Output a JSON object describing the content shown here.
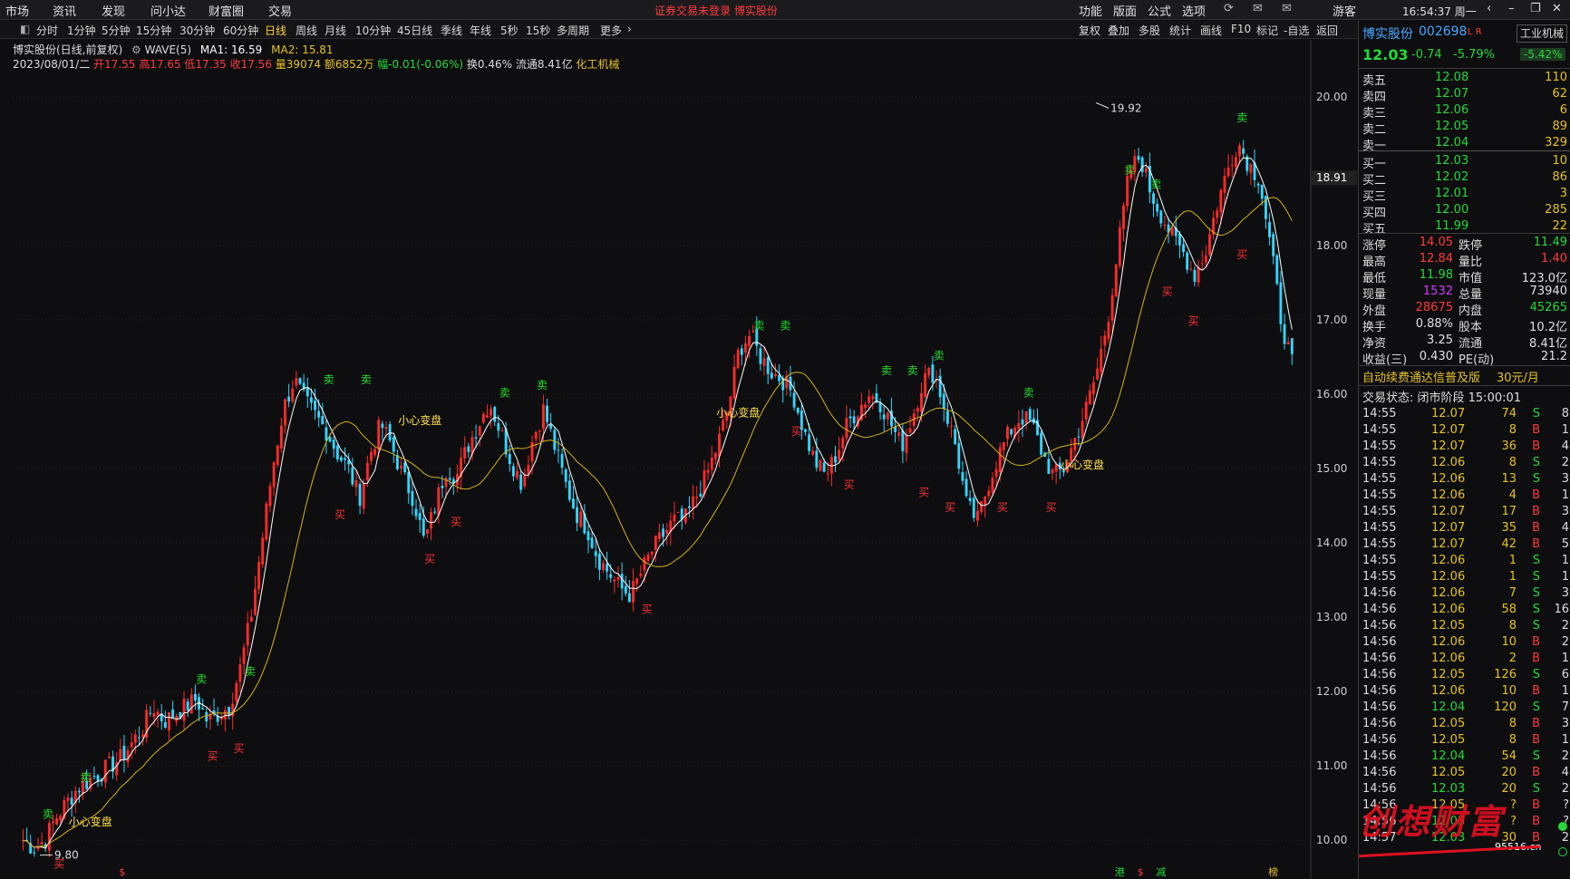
{
  "menu": [
    "市场",
    "资讯",
    "发现",
    "问小达",
    "财富圈",
    "交易"
  ],
  "alert": "证券交易未登录  博实股份",
  "right_menu": [
    "功能",
    "版面",
    "公式",
    "选项"
  ],
  "user": "游客",
  "clock": "16:54:37 周一",
  "periods": [
    "分时",
    "1分钟",
    "5分钟",
    "15分钟",
    "30分钟",
    "60分钟",
    "日线",
    "周线",
    "月线",
    "10分钟",
    "45日线",
    "季线",
    "年线",
    "5秒",
    "15秒",
    "多周期",
    "更多"
  ],
  "active_period": "日线",
  "tools": [
    "复权",
    "叠加",
    "多股",
    "统计",
    "画线",
    "F10",
    "标记",
    "-自选",
    "返回"
  ],
  "chart_title": "博实股份(日线,前复权)",
  "indicators": {
    "wave": "WAVE(5)",
    "ma1": "MA1: 16.59",
    "ma2": "MA2: 15.81"
  },
  "day_info": {
    "date": "2023/08/01/二",
    "open": "开17.55",
    "high": "高17.65",
    "low": "低17.35",
    "close": "收17.56",
    "volume": "量39074",
    "amount": "额6852万",
    "change": "幅-0.01(-0.06%)",
    "turnover": "换0.46%",
    "float": "流通8.41亿",
    "industry": "化工机械"
  },
  "price_axis": [
    "20.00",
    "18.00",
    "17.00",
    "16.00",
    "15.00",
    "14.00",
    "13.00",
    "12.00",
    "11.00",
    "10.00"
  ],
  "price_marker": "18.91",
  "max_label": "19.92",
  "min_label": "9.80",
  "signals": {
    "buy": "买",
    "sell": "卖",
    "caution": "小心变盘"
  },
  "bottom_marks": [
    "港",
    "$",
    "减",
    "榜"
  ],
  "colors": {
    "up": "#ff2a2a",
    "down": "#33d6ff",
    "ma1": "#ffffff",
    "ma2": "#d4b21e",
    "sell": "#26e02b",
    "buy": "#ff3030"
  },
  "quote": {
    "name": "博实股份",
    "code": "002698",
    "tag": "L R",
    "sector_button": "工业机械",
    "price": "12.03",
    "change": "-0.74",
    "pct": "-5.79%",
    "sector_pct": "-5.42%"
  },
  "asks": [
    {
      "label": "卖五",
      "price": "12.08",
      "vol": "110"
    },
    {
      "label": "卖四",
      "price": "12.07",
      "vol": "62"
    },
    {
      "label": "卖三",
      "price": "12.06",
      "vol": "6"
    },
    {
      "label": "卖二",
      "price": "12.05",
      "vol": "89"
    },
    {
      "label": "卖一",
      "price": "12.04",
      "vol": "329"
    }
  ],
  "bids": [
    {
      "label": "买一",
      "price": "12.03",
      "vol": "10"
    },
    {
      "label": "买二",
      "price": "12.02",
      "vol": "86"
    },
    {
      "label": "买三",
      "price": "12.01",
      "vol": "3"
    },
    {
      "label": "买四",
      "price": "12.00",
      "vol": "285"
    },
    {
      "label": "买五",
      "price": "11.99",
      "vol": "22"
    }
  ],
  "stats": [
    {
      "l1": "涨停",
      "v1": "14.05",
      "c1": "#ff3b3b",
      "l2": "跌停",
      "v2": "11.49",
      "c2": "#26d83a"
    },
    {
      "l1": "最高",
      "v1": "12.84",
      "c1": "#ff3b3b",
      "l2": "量比",
      "v2": "1.40",
      "c2": "#ff3b3b"
    },
    {
      "l1": "最低",
      "v1": "11.98",
      "c1": "#26d83a",
      "l2": "市值",
      "v2": "123.0亿",
      "c2": "#e0e0e0"
    },
    {
      "l1": "现量",
      "v1": "1532",
      "c1": "#d23cff",
      "l2": "总量",
      "v2": "73940",
      "c2": "#e0e0e0"
    },
    {
      "l1": "外盘",
      "v1": "28675",
      "c1": "#ff3b3b",
      "l2": "内盘",
      "v2": "45265",
      "c2": "#26d83a"
    },
    {
      "l1": "换手",
      "v1": "0.88%",
      "c1": "#e0e0e0",
      "l2": "股本",
      "v2": "10.2亿",
      "c2": "#e0e0e0"
    },
    {
      "l1": "净资",
      "v1": "3.25",
      "c1": "#e0e0e0",
      "l2": "流通",
      "v2": "8.41亿",
      "c2": "#e0e0e0"
    },
    {
      "l1": "收益(三)",
      "v1": "0.430",
      "c1": "#e0e0e0",
      "l2": "PE(动)",
      "v2": "21.2",
      "c2": "#e0e0e0"
    }
  ],
  "promo": {
    "text": "自动续费通达信普及版",
    "price": "30元/月"
  },
  "status": "交易状态: 闭市阶段 15:00:01",
  "ticks": [
    {
      "t": "14:55",
      "p": "12.07",
      "v": "74",
      "s": "S",
      "n": "8"
    },
    {
      "t": "14:55",
      "p": "12.07",
      "v": "8",
      "s": "B",
      "n": "1"
    },
    {
      "t": "14:55",
      "p": "12.07",
      "v": "36",
      "s": "B",
      "n": "4"
    },
    {
      "t": "14:55",
      "p": "12.06",
      "v": "8",
      "s": "S",
      "n": "2"
    },
    {
      "t": "14:55",
      "p": "12.06",
      "v": "13",
      "s": "S",
      "n": "3"
    },
    {
      "t": "14:55",
      "p": "12.06",
      "v": "4",
      "s": "B",
      "n": "1"
    },
    {
      "t": "14:55",
      "p": "12.07",
      "v": "17",
      "s": "B",
      "n": "3"
    },
    {
      "t": "14:55",
      "p": "12.07",
      "v": "35",
      "s": "B",
      "n": "4"
    },
    {
      "t": "14:55",
      "p": "12.07",
      "v": "42",
      "s": "B",
      "n": "5"
    },
    {
      "t": "14:55",
      "p": "12.06",
      "v": "1",
      "s": "S",
      "n": "1"
    },
    {
      "t": "14:55",
      "p": "12.06",
      "v": "1",
      "s": "S",
      "n": "1"
    },
    {
      "t": "14:56",
      "p": "12.06",
      "v": "7",
      "s": "S",
      "n": "3"
    },
    {
      "t": "14:56",
      "p": "12.06",
      "v": "58",
      "s": "S",
      "n": "16"
    },
    {
      "t": "14:56",
      "p": "12.05",
      "v": "8",
      "s": "S",
      "n": "2"
    },
    {
      "t": "14:56",
      "p": "12.06",
      "v": "10",
      "s": "B",
      "n": "2"
    },
    {
      "t": "14:56",
      "p": "12.06",
      "v": "2",
      "s": "B",
      "n": "1"
    },
    {
      "t": "14:56",
      "p": "12.05",
      "v": "126",
      "s": "S",
      "n": "6"
    },
    {
      "t": "14:56",
      "p": "12.06",
      "v": "10",
      "s": "B",
      "n": "1"
    },
    {
      "t": "14:56",
      "p": "12.04",
      "v": "120",
      "s": "S",
      "n": "7"
    },
    {
      "t": "14:56",
      "p": "12.05",
      "v": "8",
      "s": "B",
      "n": "3"
    },
    {
      "t": "14:56",
      "p": "12.05",
      "v": "8",
      "s": "B",
      "n": "1"
    },
    {
      "t": "14:56",
      "p": "12.04",
      "v": "54",
      "s": "S",
      "n": "2"
    },
    {
      "t": "14:56",
      "p": "12.05",
      "v": "20",
      "s": "B",
      "n": "4"
    },
    {
      "t": "14:56",
      "p": "12.03",
      "v": "20",
      "s": "S",
      "n": "2"
    },
    {
      "t": "14:56",
      "p": "12.05",
      "v": "?",
      "s": "B",
      "n": "?"
    },
    {
      "t": "14:56",
      "p": "12.03",
      "v": "?",
      "s": "B",
      "n": "?"
    },
    {
      "t": "14:57",
      "p": "12.03",
      "v": "30",
      "s": "B",
      "n": "2"
    }
  ],
  "watermark": "创想财富",
  "watermark_site": "95516.cn",
  "chart_data": {
    "type": "candlestick",
    "ylim": [
      9.6,
      20.4
    ],
    "y_ticks": [
      20,
      18,
      17,
      16,
      15,
      14,
      13,
      12,
      11,
      10
    ],
    "max": 19.92,
    "min": 9.8,
    "close_path": [
      10.0,
      9.9,
      10.0,
      10.3,
      10.5,
      10.7,
      10.8,
      10.9,
      11.0,
      11.1,
      11.3,
      11.5,
      11.8,
      11.6,
      11.7,
      11.8,
      11.9,
      11.6,
      11.7,
      11.8,
      12.3,
      13.0,
      14.0,
      15.0,
      15.8,
      16.2,
      15.9,
      15.7,
      15.5,
      15.2,
      15.0,
      14.6,
      15.2,
      15.6,
      15.3,
      14.9,
      14.6,
      14.0,
      14.5,
      15.0,
      14.9,
      15.3,
      15.6,
      15.9,
      15.5,
      15.1,
      14.8,
      15.4,
      15.8,
      15.3,
      14.8,
      14.4,
      14.2,
      13.8,
      13.6,
      13.4,
      13.3,
      13.6,
      13.9,
      14.1,
      14.3,
      14.3,
      14.6,
      14.9,
      15.3,
      15.8,
      16.6,
      16.8,
      16.5,
      16.3,
      16.2,
      16.0,
      15.5,
      15.1,
      14.9,
      15.2,
      15.6,
      15.8,
      16.0,
      15.9,
      15.6,
      15.3,
      15.7,
      16.2,
      16.3,
      15.8,
      15.3,
      14.5,
      14.3,
      14.8,
      15.2,
      15.5,
      15.7,
      15.6,
      15.2,
      14.9,
      15.0,
      15.4,
      15.8,
      16.3,
      17.0,
      18.0,
      19.0,
      19.2,
      18.7,
      18.4,
      18.1,
      17.9,
      17.6,
      17.9,
      18.5,
      19.0,
      19.4,
      19.1,
      18.9,
      18.0,
      17.0,
      16.4
    ]
  }
}
